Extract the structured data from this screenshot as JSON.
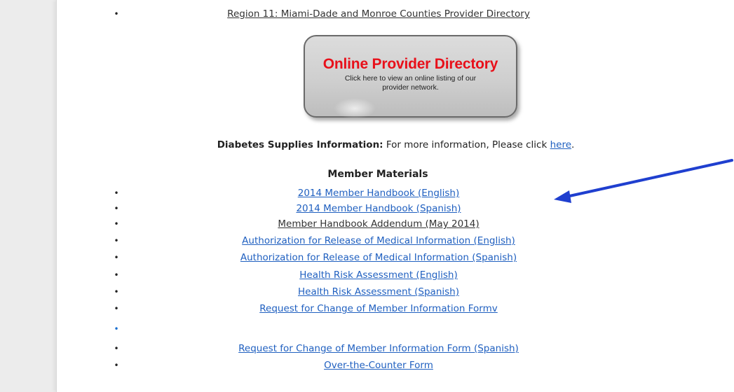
{
  "top_link": "Region 11: Miami-Dade and Monroe Counties Provider Directory",
  "provider_button": {
    "title": "Online Provider Directory",
    "subtitle": "Click here to view an online listing of our provider network."
  },
  "diabetes": {
    "label": "Diabetes Supplies Information:",
    "text": " For more information, Please click ",
    "link": "here",
    "end": "."
  },
  "member_materials": {
    "heading": "Member Materials",
    "items": [
      "2014 Member Handbook (English)",
      "2014 Member Handbook (Spanish)",
      "Member Handbook Addendum (May 2014)",
      "Authorization for Release of Medical Information (English)",
      "Authorization for Release of Medical Information (Spanish)",
      "Health Risk Assessment (English)",
      "Health Risk Assessment (Spanish)",
      "Request for Change of Member Information Formv",
      "",
      "Request for Change of Member Information Form (Spanish)",
      "Over-the-Counter Form"
    ]
  },
  "colors": {
    "link": "#2060c0",
    "button_title": "#e8101a",
    "annotation_arrow": "#1f3fcf"
  }
}
